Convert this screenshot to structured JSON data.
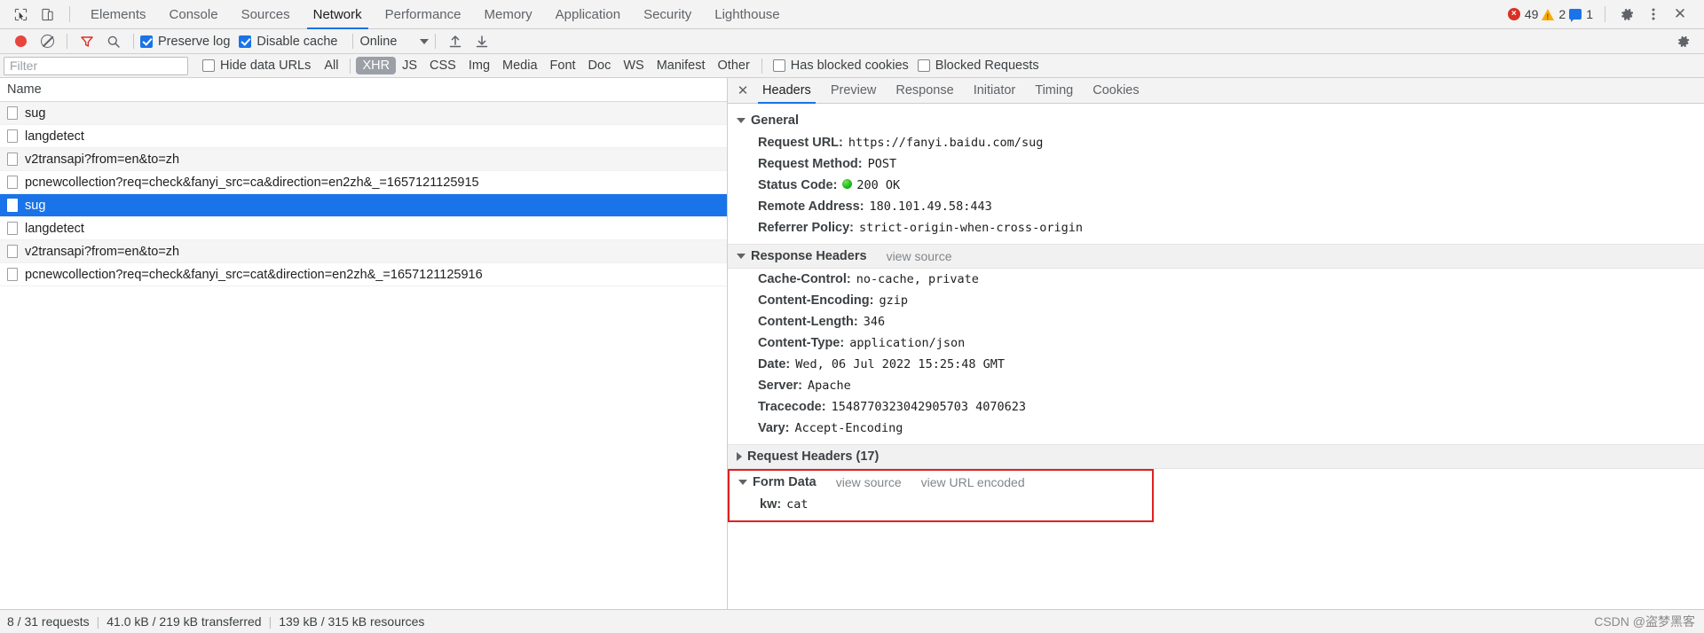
{
  "tabbar": {
    "inspect_icon": "inspect-cursor-icon",
    "device_icon": "device-toolbar-icon",
    "tabs": [
      {
        "label": "Elements",
        "active": false
      },
      {
        "label": "Console",
        "active": false
      },
      {
        "label": "Sources",
        "active": false
      },
      {
        "label": "Network",
        "active": true
      },
      {
        "label": "Performance",
        "active": false
      },
      {
        "label": "Memory",
        "active": false
      },
      {
        "label": "Application",
        "active": false
      },
      {
        "label": "Security",
        "active": false
      },
      {
        "label": "Lighthouse",
        "active": false
      }
    ],
    "counters": {
      "errors": "49",
      "warnings": "2",
      "info": "1",
      "error_glyph": "×",
      "warning_glyph": "!"
    },
    "settings_icon": "gear-icon",
    "more_icon": "kebab-menu-icon",
    "close_icon": "close-icon",
    "close_glyph": "✕"
  },
  "toolbar": {
    "record_icon": "record-button-icon",
    "clear_icon": "clear-icon",
    "filter_icon": "filter-funnel-icon",
    "search_icon": "search-icon",
    "preserve_log": {
      "label": "Preserve log",
      "checked": true
    },
    "disable_cache": {
      "label": "Disable cache",
      "checked": true
    },
    "throttling": {
      "value": "Online"
    },
    "import_icon": "import-har-icon",
    "export_icon": "export-har-icon",
    "settings_icon": "network-settings-gear-icon"
  },
  "filterbar": {
    "filter_placeholder": "Filter",
    "filter_value": "",
    "hide_data_urls": {
      "label": "Hide data URLs",
      "checked": false
    },
    "types": [
      {
        "label": "All",
        "active": false
      },
      {
        "label": "XHR",
        "active": true
      },
      {
        "label": "JS",
        "active": false
      },
      {
        "label": "CSS",
        "active": false
      },
      {
        "label": "Img",
        "active": false
      },
      {
        "label": "Media",
        "active": false
      },
      {
        "label": "Font",
        "active": false
      },
      {
        "label": "Doc",
        "active": false
      },
      {
        "label": "WS",
        "active": false
      },
      {
        "label": "Manifest",
        "active": false
      },
      {
        "label": "Other",
        "active": false
      }
    ],
    "has_blocked_cookies": {
      "label": "Has blocked cookies",
      "checked": false
    },
    "blocked_requests": {
      "label": "Blocked Requests",
      "checked": false
    }
  },
  "requests": {
    "column_header": "Name",
    "rows": [
      {
        "name": "sug",
        "selected": false
      },
      {
        "name": "langdetect",
        "selected": false
      },
      {
        "name": "v2transapi?from=en&to=zh",
        "selected": false
      },
      {
        "name": "pcnewcollection?req=check&fanyi_src=ca&direction=en2zh&_=1657121125915",
        "selected": false
      },
      {
        "name": "sug",
        "selected": true
      },
      {
        "name": "langdetect",
        "selected": false
      },
      {
        "name": "v2transapi?from=en&to=zh",
        "selected": false
      },
      {
        "name": "pcnewcollection?req=check&fanyi_src=cat&direction=en2zh&_=1657121125916",
        "selected": false
      }
    ]
  },
  "detail": {
    "close_glyph": "✕",
    "tabs": [
      {
        "label": "Headers",
        "active": true
      },
      {
        "label": "Preview",
        "active": false
      },
      {
        "label": "Response",
        "active": false
      },
      {
        "label": "Initiator",
        "active": false
      },
      {
        "label": "Timing",
        "active": false
      },
      {
        "label": "Cookies",
        "active": false
      }
    ],
    "general": {
      "title": "General",
      "rows": [
        {
          "key": "Request URL:",
          "value": "https://fanyi.baidu.com/sug"
        },
        {
          "key": "Request Method:",
          "value": "POST"
        },
        {
          "key": "Status Code:",
          "value": "200 OK",
          "status_dot": true
        },
        {
          "key": "Remote Address:",
          "value": "180.101.49.58:443"
        },
        {
          "key": "Referrer Policy:",
          "value": "strict-origin-when-cross-origin"
        }
      ]
    },
    "response_headers": {
      "title": "Response Headers",
      "view_source": "view source",
      "rows": [
        {
          "key": "Cache-Control:",
          "value": "no-cache, private"
        },
        {
          "key": "Content-Encoding:",
          "value": "gzip"
        },
        {
          "key": "Content-Length:",
          "value": "346"
        },
        {
          "key": "Content-Type:",
          "value": "application/json"
        },
        {
          "key": "Date:",
          "value": "Wed, 06 Jul 2022 15:25:48 GMT"
        },
        {
          "key": "Server:",
          "value": "Apache"
        },
        {
          "key": "Tracecode:",
          "value": "1548770323042905703 4070623"
        },
        {
          "key": "Vary:",
          "value": "Accept-Encoding"
        }
      ]
    },
    "request_headers": {
      "title": "Request Headers (17)"
    },
    "form_data": {
      "title": "Form Data",
      "view_source": "view source",
      "view_url_encoded": "view URL encoded",
      "highlight_color": "#e02020",
      "rows": [
        {
          "key": "kw:",
          "value": "cat"
        }
      ]
    }
  },
  "statusbar": {
    "requests": "8 / 31 requests",
    "transferred": "41.0 kB / 219 kB transferred",
    "resources": "139 kB / 315 kB resources",
    "watermark": "CSDN @盗梦黑客"
  }
}
